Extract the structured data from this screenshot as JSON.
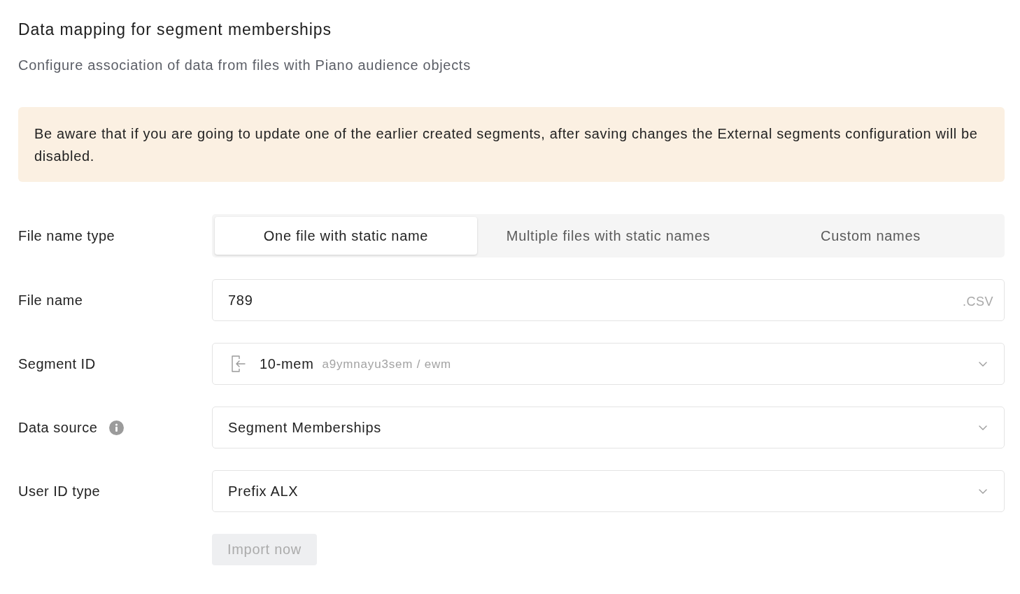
{
  "header": {
    "title": "Data mapping for segment memberships",
    "subtitle": "Configure association of data from files with Piano audience objects"
  },
  "alert": {
    "text": "Be aware that if you are going to update one of the earlier created segments, after saving changes the External segments configuration will be disabled."
  },
  "form": {
    "rows": [
      {
        "kind": "tabs",
        "label": "File name type",
        "info": false,
        "tabs": [
          {
            "label": "One file with static name",
            "selected": true
          },
          {
            "label": "Multiple files with static names",
            "selected": false
          },
          {
            "label": "Custom names",
            "selected": false
          }
        ]
      },
      {
        "kind": "text",
        "label": "File name",
        "info": false,
        "value": "789",
        "suffix": ".CSV"
      },
      {
        "kind": "segment",
        "label": "Segment ID",
        "info": false,
        "value": "10-mem",
        "detail": "a9ymnayu3sem / ewm"
      },
      {
        "kind": "select",
        "label": "Data source",
        "info": true,
        "value": "Segment Memberships"
      },
      {
        "kind": "select",
        "label": "User ID type",
        "info": false,
        "value": "Prefix ALX"
      }
    ]
  },
  "actions": [
    {
      "label": "Import now",
      "disabled": true
    }
  ]
}
